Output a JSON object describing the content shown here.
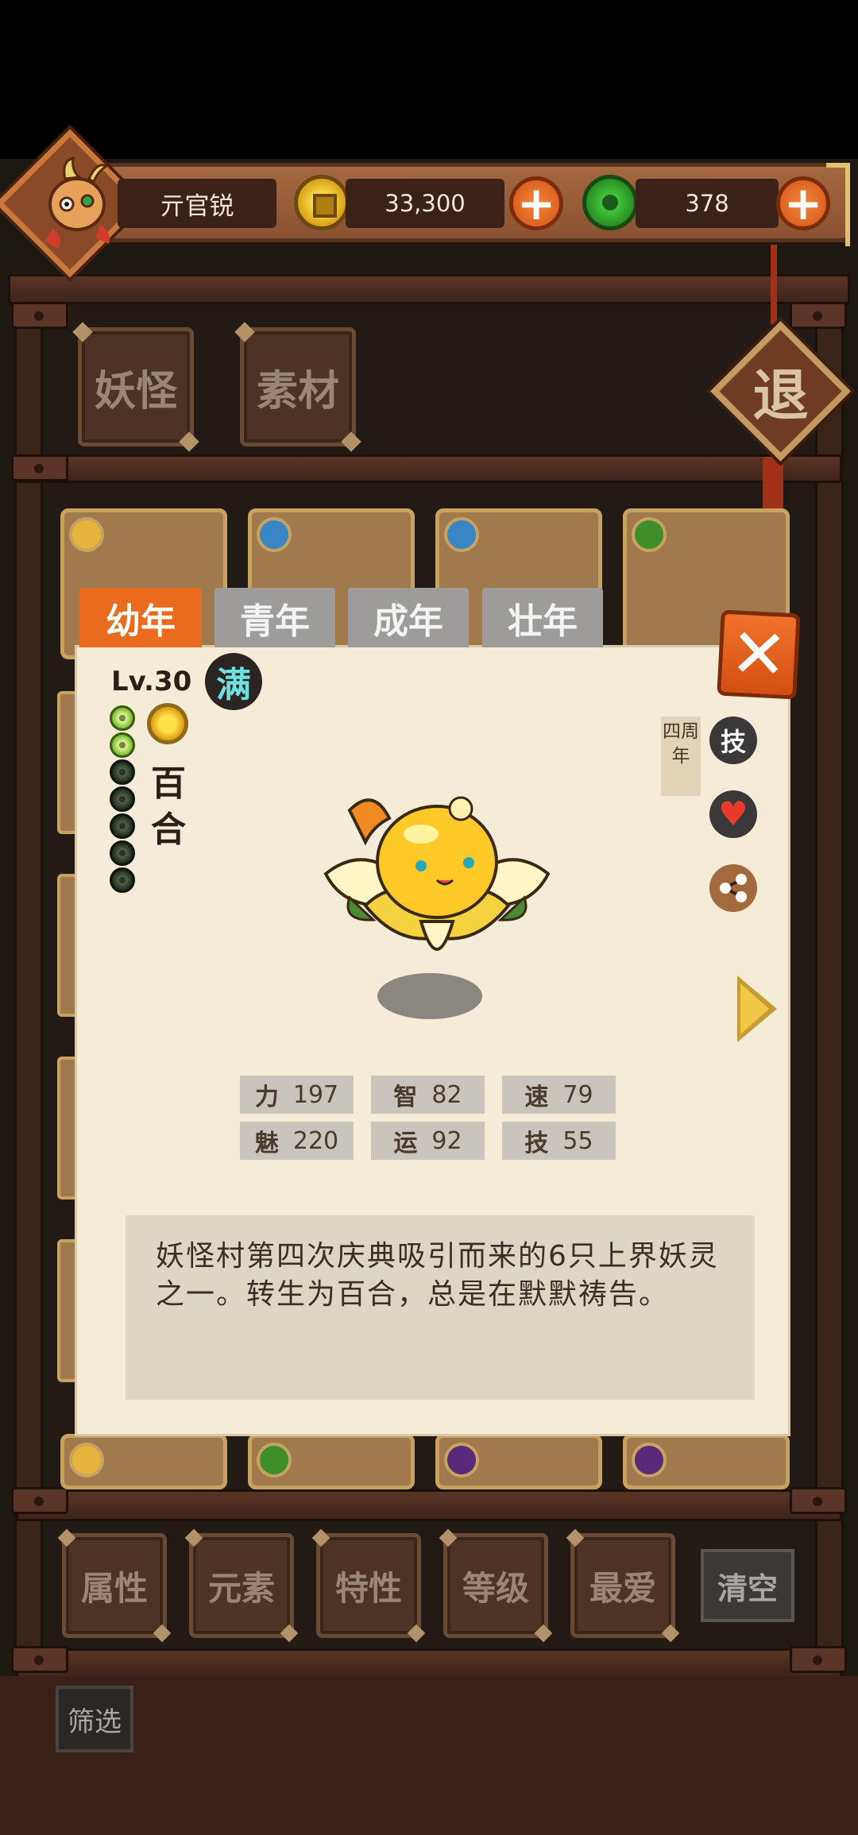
{
  "header": {
    "username": "亓官锐",
    "gold": "33,300",
    "jade": "378",
    "plus_symbol": "+"
  },
  "categories": [
    {
      "label": "妖怪"
    },
    {
      "label": "素材"
    }
  ],
  "exit_label": "退",
  "tabs": [
    {
      "label": "幼年",
      "active": true
    },
    {
      "label": "青年",
      "active": false
    },
    {
      "label": "成年",
      "active": false
    },
    {
      "label": "壮年",
      "active": false
    }
  ],
  "close_symbol": "✕",
  "creature": {
    "level": "Lv.30",
    "full_badge": "满",
    "name": "百合",
    "pips_filled": 2,
    "pips_total": 7,
    "anniversary_tag": "四周年",
    "skill_icon_label": "技",
    "heart_symbol": "♥",
    "stats": [
      {
        "key": "力",
        "value": "197"
      },
      {
        "key": "智",
        "value": "82"
      },
      {
        "key": "速",
        "value": "79"
      },
      {
        "key": "魅",
        "value": "220"
      },
      {
        "key": "运",
        "value": "92"
      },
      {
        "key": "技",
        "value": "55"
      }
    ],
    "description": "妖怪村第四次庆典吸引而来的6只上界妖灵之一。转生为百合，总是在默默祷告。"
  },
  "filters": [
    {
      "label": "属性"
    },
    {
      "label": "元素"
    },
    {
      "label": "特性"
    },
    {
      "label": "等级"
    },
    {
      "label": "最爱"
    }
  ],
  "clear_label": "清空",
  "screen_label": "筛选",
  "colors": {
    "tab_active": "#ea6b1e",
    "tab_inactive": "#9d9c9b",
    "dialog_bg": "#f5ecd7",
    "close_button": "#e8621f"
  }
}
